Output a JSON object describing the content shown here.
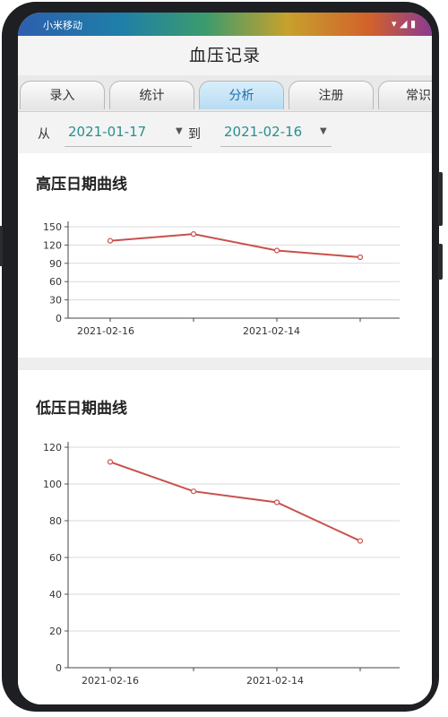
{
  "status_bar": {
    "carrier": "小米移动",
    "icons": "▾ ◢ ▮"
  },
  "app": {
    "title": "血压记录"
  },
  "tabs": [
    {
      "label": "录入"
    },
    {
      "label": "统计"
    },
    {
      "label": "分析",
      "active": true
    },
    {
      "label": "注册"
    },
    {
      "label": "常识"
    }
  ],
  "filter": {
    "from_label": "从",
    "from_date": "2021-01-17",
    "to_label": "到",
    "to_date": "2021-02-16"
  },
  "chart_data": [
    {
      "type": "line",
      "title": "高压日期曲线",
      "x_ticks": [
        "2021-02-16",
        "2021-02-14"
      ],
      "y_ticks": [
        0,
        30,
        60,
        90,
        120,
        150
      ],
      "ylim": [
        0,
        150
      ],
      "grid": true,
      "series": [
        {
          "values": [
            127,
            138,
            111,
            100
          ],
          "color": "#c9504b"
        }
      ]
    },
    {
      "type": "line",
      "title": "低压日期曲线",
      "x_ticks": [
        "2021-02-16",
        "2021-02-14"
      ],
      "y_ticks": [
        0,
        20,
        40,
        60,
        80,
        100,
        120
      ],
      "ylim": [
        0,
        120
      ],
      "grid": true,
      "series": [
        {
          "values": [
            112,
            96,
            90,
            69
          ],
          "color": "#c9504b"
        }
      ]
    }
  ]
}
